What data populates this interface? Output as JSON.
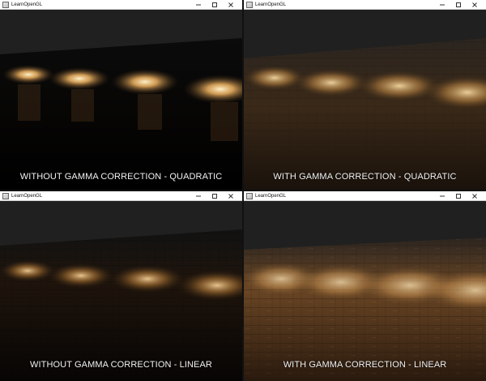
{
  "windows": [
    {
      "id": "tl",
      "title": "LearnOpenGL",
      "caption": "WITHOUT GAMMA CORRECTION - QUADRATIC",
      "variant": "without-quadratic"
    },
    {
      "id": "tr",
      "title": "LearnOpenGL",
      "caption": "WITH GAMMA CORRECTION - QUADRATIC",
      "variant": "with-quadratic"
    },
    {
      "id": "bl",
      "title": "LearnOpenGL",
      "caption": "WITHOUT GAMMA CORRECTION - LINEAR",
      "variant": "without-linear"
    },
    {
      "id": "br",
      "title": "LearnOpenGL",
      "caption": "WITH GAMMA CORRECTION - LINEAR",
      "variant": "with-linear"
    }
  ],
  "colors": {
    "background": "#202020",
    "floor_dark": "#0a0704",
    "floor_wood": "#5a3a1d",
    "light": "#ffd28a",
    "caption": "#f2f2f2"
  },
  "window_controls": {
    "minimize_icon": "minimize-icon",
    "maximize_icon": "maximize-icon",
    "close_icon": "close-icon"
  }
}
